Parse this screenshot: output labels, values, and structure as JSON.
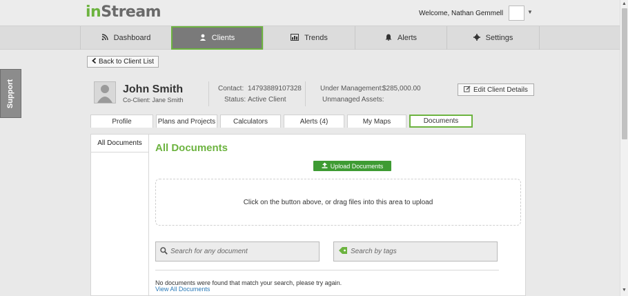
{
  "header": {
    "logo_prefix": "in",
    "logo_suffix": "Stream",
    "welcome": "Welcome, Nathan Gemmell"
  },
  "nav": {
    "items": [
      {
        "label": "Dashboard",
        "icon": "rss-icon"
      },
      {
        "label": "Clients",
        "icon": "user-icon"
      },
      {
        "label": "Trends",
        "icon": "chart-icon"
      },
      {
        "label": "Alerts",
        "icon": "bell-icon"
      },
      {
        "label": "Settings",
        "icon": "gear-icon"
      }
    ]
  },
  "support": "Support",
  "back_label": "Back to Client List",
  "client": {
    "name": "John Smith",
    "co_client": "Co-Client: Jane Smith",
    "contact_label": "Contact:",
    "contact_value": "14793889107328",
    "status_label": "Status:",
    "status_value": "Active Client",
    "under_mgmt_label": "Under Management:",
    "under_mgmt_value": "$285,000.00",
    "unmanaged_label": "Unmanaged Assets:",
    "edit_label": "Edit Client Details"
  },
  "tabs": [
    "Profile",
    "Plans and Projects",
    "Calculators",
    "Alerts (4)",
    "My Maps",
    "Documents"
  ],
  "documents": {
    "side_tab": "All Documents",
    "title": "All Documents",
    "upload_label": "Upload Documents",
    "dropzone_text": "Click on the button above, or drag files into this area to upload",
    "search_placeholder": "Search for any document",
    "tags_placeholder": "Search by tags",
    "no_results": "No documents were found that match your search, please try again.",
    "view_all": "View All Documents"
  },
  "colors": {
    "accent": "#6cb33f",
    "upload_button": "#3e9b33",
    "link": "#2a7ab8"
  }
}
